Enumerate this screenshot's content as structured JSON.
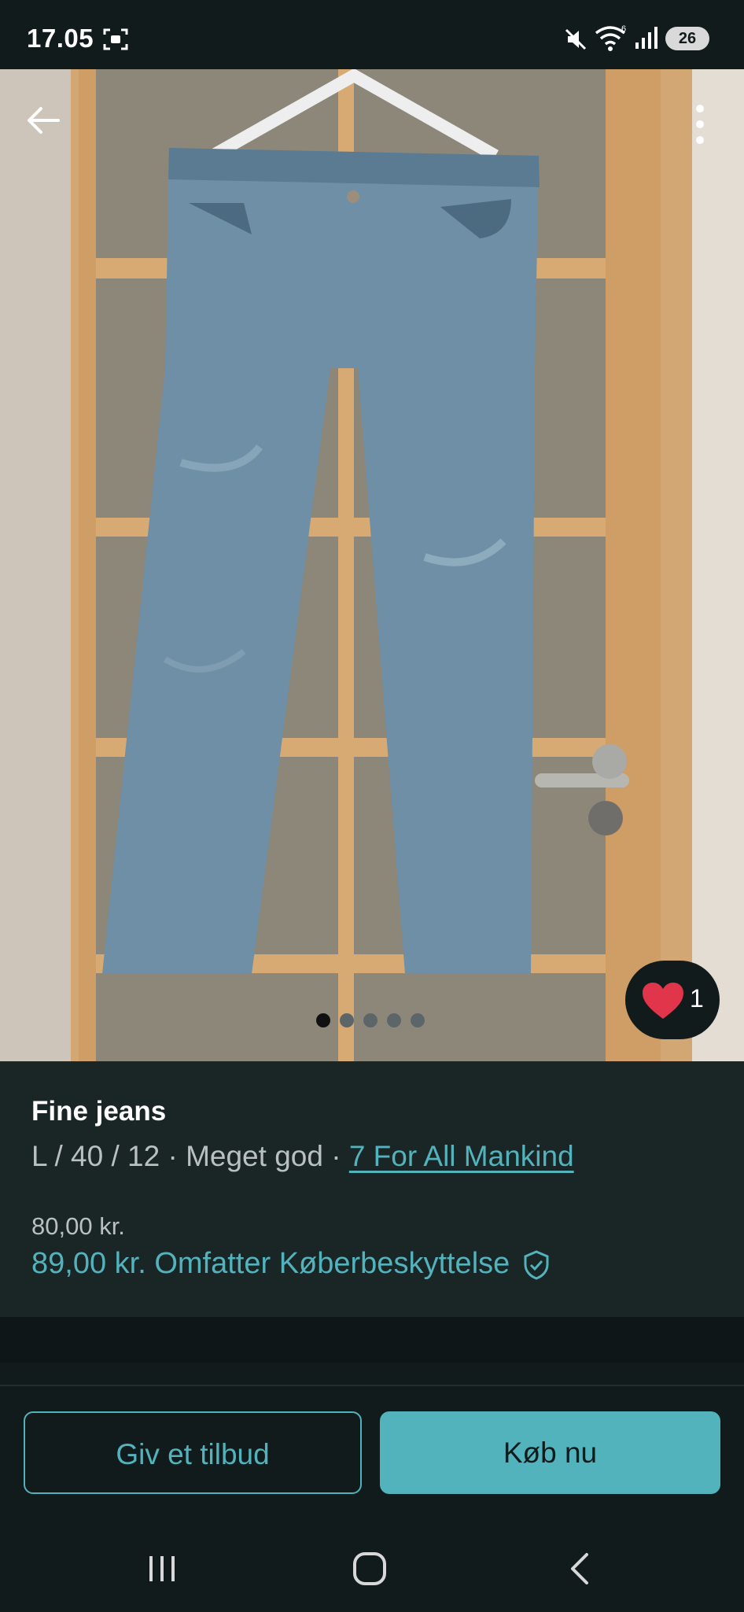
{
  "status_bar": {
    "time": "17.05",
    "battery": "26"
  },
  "product": {
    "title": "Fine jeans",
    "details_prefix": "L / 40 / 12 · Meget god · ",
    "brand": "7 For All Mankind",
    "price": "80,00 kr.",
    "price_with_protection": "89,00 kr.",
    "protection_text": "Omfatter Køberbeskyttelse"
  },
  "gallery": {
    "image_count": 5,
    "active_index": 0,
    "like_count": "1"
  },
  "actions": {
    "offer_label": "Giv et tilbud",
    "buy_label": "Køb nu"
  },
  "colors": {
    "accent": "#52b3bc",
    "background": "#121b1c",
    "like": "#e0354a"
  },
  "icons": [
    "back-arrow-icon",
    "more-vert-icon",
    "heart-icon",
    "shield-check-icon",
    "recents-icon",
    "home-icon",
    "nav-back-icon",
    "screenshot-icon",
    "mute-icon",
    "wifi-icon",
    "signal-icon"
  ]
}
